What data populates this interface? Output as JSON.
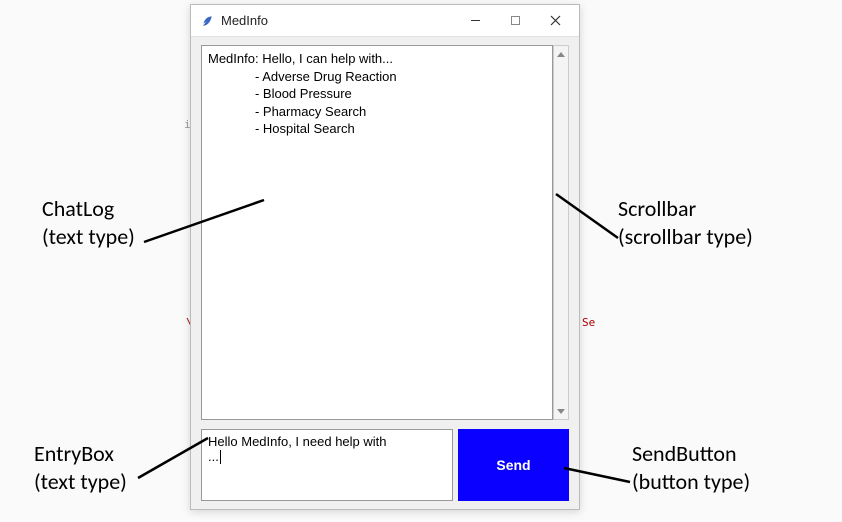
{
  "titlebar": {
    "title": "MedInfo"
  },
  "chatlog": {
    "prefix": "MedInfo: ",
    "intro": "Hello, I can help with...",
    "indent": "             ",
    "items": [
      "- Adverse Drug Reaction",
      "- Blood Pressure",
      "- Pharmacy Search",
      "- Hospital Search"
    ]
  },
  "entry": {
    "line1": "Hello MedInfo, I need help with",
    "line2": "..."
  },
  "send": {
    "label": "Send"
  },
  "annotations": {
    "chatlog_label": "ChatLog",
    "chatlog_sub": "(text type)",
    "entry_label": "EntryBox",
    "entry_sub": "(text type)",
    "scrollbar_label": "Scrollbar",
    "scrollbar_sub": "(scrollbar type)",
    "send_label": "SendButton",
    "send_sub": "(button type)"
  }
}
